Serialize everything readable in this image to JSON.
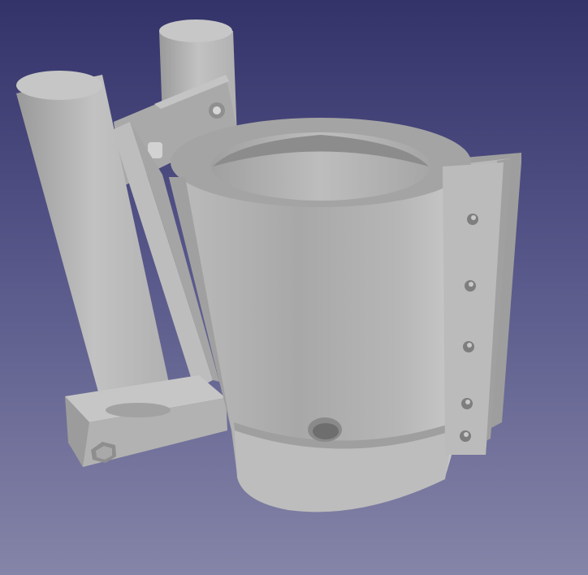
{
  "viewport": {
    "background_top": "#33336a",
    "background_bottom": "#8585a8",
    "model_color": "#b8b8b8"
  }
}
